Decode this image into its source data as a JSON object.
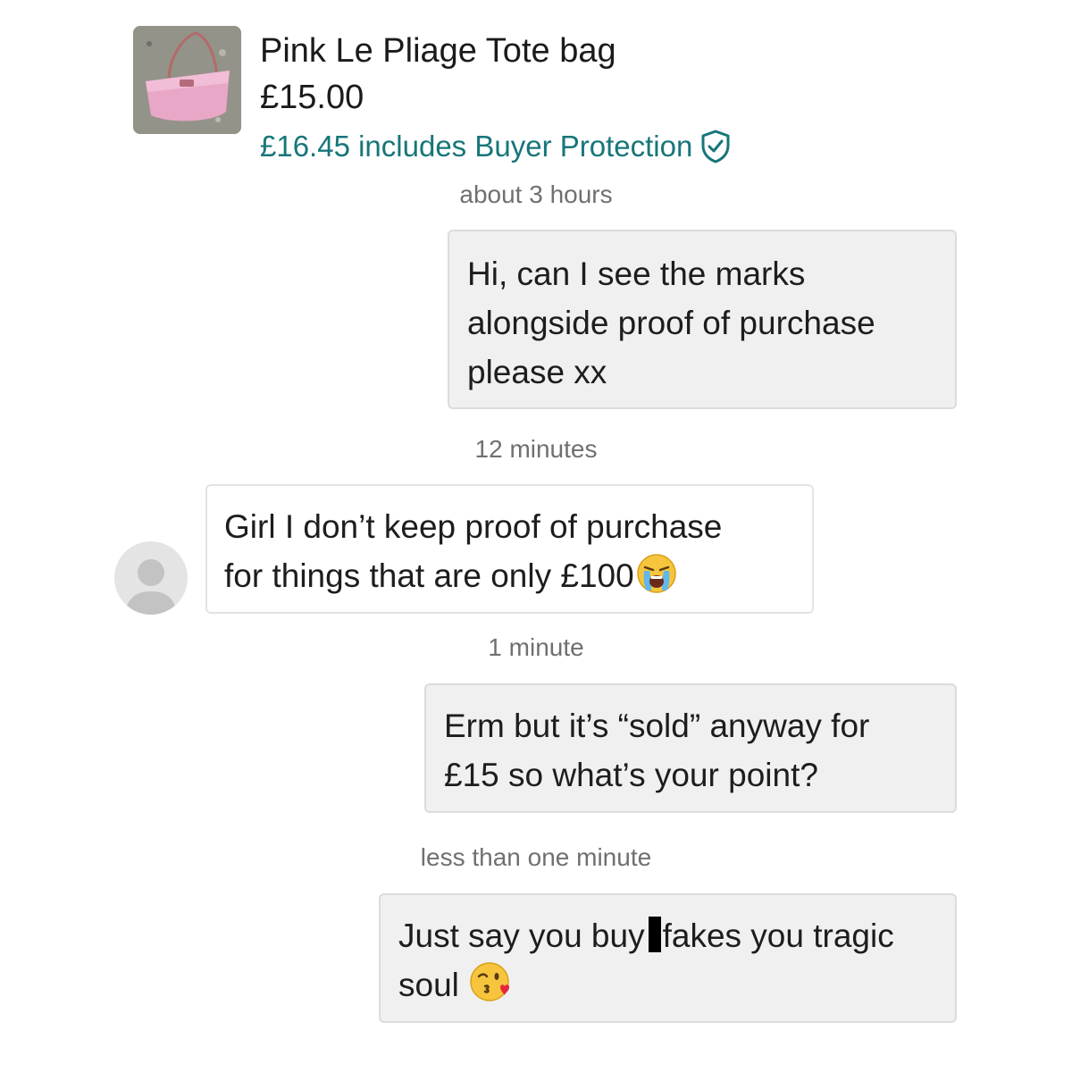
{
  "item": {
    "title": "Pink Le Pliage Tote bag",
    "price": "£15.00",
    "protection_text": "£16.45 includes Buyer Protection",
    "thumbnail_icon": "pink-tote-bag-photo"
  },
  "colors": {
    "accent": "#17767a",
    "bubble_outgoing": "#f0f0f0",
    "bubble_incoming": "#ffffff",
    "timestamp": "#707070"
  },
  "messages": [
    {
      "timestamp": "about 3 hours",
      "direction": "outgoing",
      "lines": [
        "Hi, can I see the marks",
        "alongside proof of purchase",
        "please xx"
      ]
    },
    {
      "timestamp": "12 minutes",
      "direction": "incoming",
      "lines": [
        "Girl I don’t keep proof of purchase",
        "for things that are only £100"
      ],
      "emoji": "loudly-crying-face"
    },
    {
      "timestamp": "1 minute",
      "direction": "outgoing",
      "lines": [
        "Erm but it’s “sold” anyway for",
        "£15 so what’s your point?"
      ]
    },
    {
      "timestamp": "less than one minute",
      "direction": "outgoing",
      "line1_before": "Just say you buy",
      "line1_after": "fakes you tragic",
      "line2": "soul",
      "emoji": "face-blowing-a-kiss"
    }
  ]
}
